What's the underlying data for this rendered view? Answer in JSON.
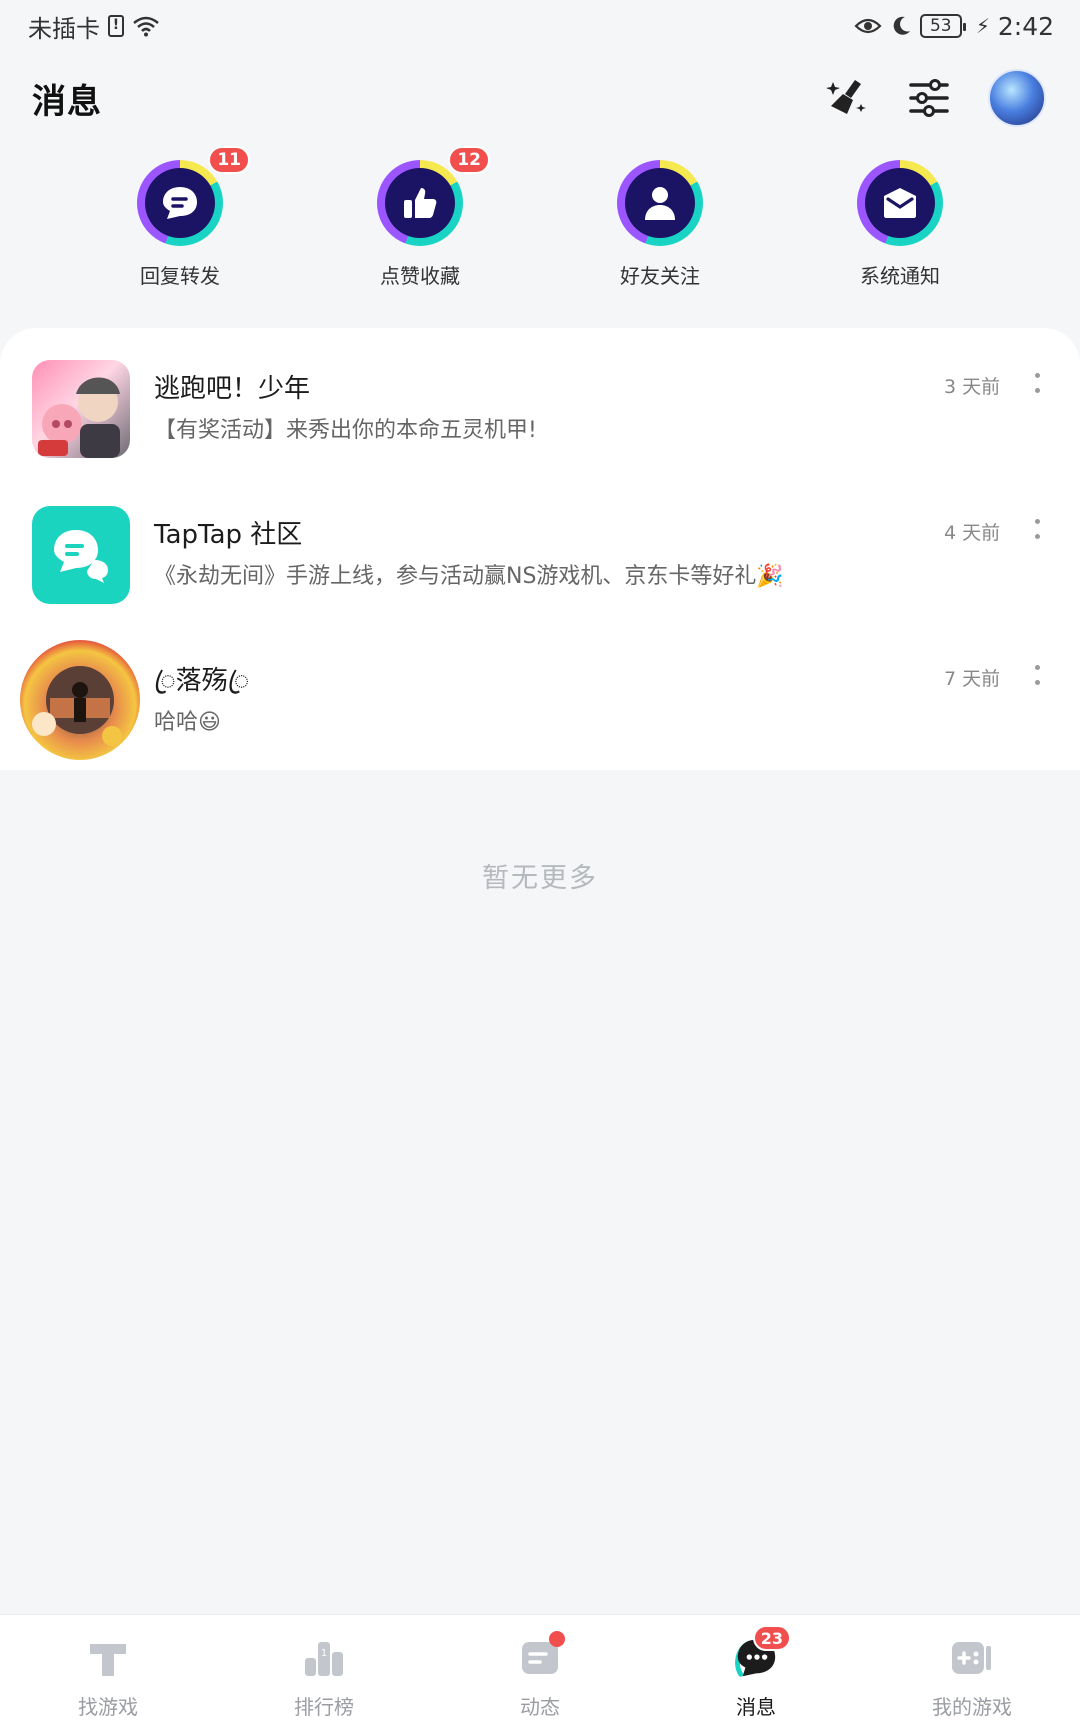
{
  "status_bar": {
    "carrier": "未插卡",
    "sim_icon_text": "!",
    "battery": "53",
    "time": "2:42"
  },
  "header": {
    "title": "消息"
  },
  "shortcuts": [
    {
      "label": "回复转发",
      "badge": "11",
      "icon": "chat-bubble-icon"
    },
    {
      "label": "点赞收藏",
      "badge": "12",
      "icon": "thumbs-up-icon"
    },
    {
      "label": "好友关注",
      "badge": "",
      "icon": "person-icon"
    },
    {
      "label": "系统通知",
      "badge": "",
      "icon": "envelope-icon"
    }
  ],
  "messages": [
    {
      "name": "逃跑吧！少年",
      "preview": "【有奖活动】来秀出你的本命五灵机甲!",
      "time": "3 天前"
    },
    {
      "name": "TapTap 社区",
      "preview": "《永劫无间》手游上线，参与活动赢NS游戏机、京东卡等好礼🎉",
      "time": "4 天前"
    },
    {
      "name": "ꦿ落殇ꦿ",
      "preview": "哈哈😃",
      "time": "7 天前"
    }
  ],
  "no_more_text": "暂无更多",
  "bottom_nav": [
    {
      "label": "找游戏",
      "icon": "tap-icon"
    },
    {
      "label": "排行榜",
      "icon": "ranking-icon"
    },
    {
      "label": "动态",
      "icon": "feed-icon"
    },
    {
      "label": "消息",
      "icon": "message-icon",
      "badge": "23"
    },
    {
      "label": "我的游戏",
      "icon": "gamepad-icon"
    }
  ],
  "colors": {
    "accent_teal": "#19d3c5",
    "badge_red": "#f14e4e",
    "icon_navy": "#1b1464"
  }
}
